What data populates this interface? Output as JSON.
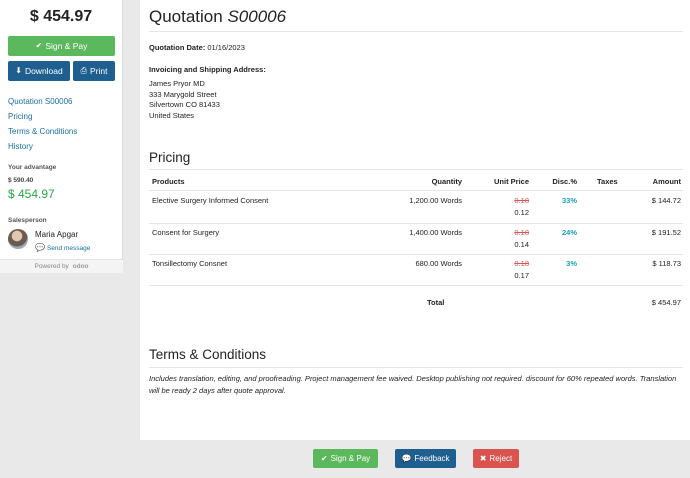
{
  "sidebar": {
    "total": "$ 454.97",
    "sign_pay_label": "Sign & Pay",
    "download_label": "Download",
    "print_label": "Print",
    "nav": [
      "Quotation S00006",
      "Pricing",
      "Terms & Conditions",
      "History"
    ],
    "advantage_label": "Your advantage",
    "old_price": "$ 590.40",
    "new_price": "$ 454.97",
    "salesperson_label": "Salesperson",
    "salesperson_name": "Maria Apgar",
    "send_message_label": "Send message",
    "powered_by": "Powered by",
    "powered_brand": "odoo"
  },
  "document": {
    "title_prefix": "Quotation",
    "title_number": "S00006",
    "date_label": "Quotation Date:",
    "date_value": "01/16/2023",
    "address_label": "Invoicing and Shipping Address:",
    "address_lines": [
      "James Pryor MD",
      "333 Marygold Street",
      "Silvertown CO 81433",
      "United States"
    ],
    "pricing_title": "Pricing",
    "columns": {
      "products": "Products",
      "quantity": "Quantity",
      "unit_price": "Unit Price",
      "disc": "Disc.%",
      "taxes": "Taxes",
      "amount": "Amount"
    },
    "lines": [
      {
        "product": "Elective Surgery Informed Consent",
        "quantity": "1,200.00 Words",
        "orig_price": "0.18",
        "unit_price": "0.12",
        "disc": "33%",
        "taxes": "",
        "amount": "$ 144.72"
      },
      {
        "product": "Consent for Surgery",
        "quantity": "1,400.00 Words",
        "orig_price": "0.18",
        "unit_price": "0.14",
        "disc": "24%",
        "taxes": "",
        "amount": "$ 191.52"
      },
      {
        "product": "Tonsillectomy Consnet",
        "quantity": "680.00 Words",
        "orig_price": "0.18",
        "unit_price": "0.17",
        "disc": "3%",
        "taxes": "",
        "amount": "$ 118.73"
      }
    ],
    "total_label": "Total",
    "total_value": "$ 454.97",
    "terms_title": "Terms & Conditions",
    "terms_text": "Includes translation, editing, and proofreading. Project management fee waived. Desktop publishing not required. discount for 60% repeated words. Translation will be ready 2 days after quote approval."
  },
  "footer": {
    "sign_pay_label": "Sign & Pay",
    "feedback_label": "Feedback",
    "reject_label": "Reject"
  },
  "colors": {
    "success": "#5cb85c",
    "primary": "#1f5f8f",
    "danger": "#d9534f",
    "link": "#1a6fa3",
    "discount": "#17a2b8",
    "advantage": "#28a745"
  }
}
